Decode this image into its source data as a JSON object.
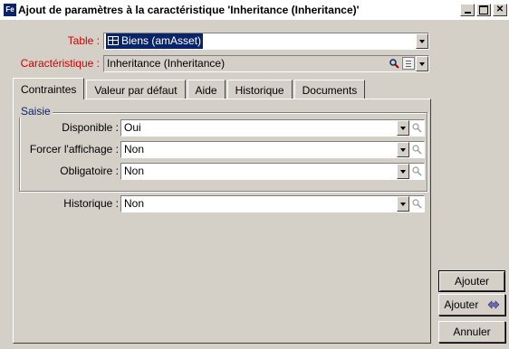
{
  "window": {
    "title": "Ajout de paramètres à la caractéristique 'Inheritance (Inheritance)'",
    "icon": "feature-window-icon",
    "buttons": [
      "minimize",
      "maximize",
      "close"
    ]
  },
  "header": {
    "table_label": "Table :",
    "table_value": "Biens (amAsset)",
    "characteristic_label": "Caractéristique :",
    "characteristic_value": "Inheritance (Inheritance)"
  },
  "tabs": [
    {
      "label": "Contraintes",
      "active": true
    },
    {
      "label": "Valeur par défaut",
      "active": false
    },
    {
      "label": "Aide",
      "active": false
    },
    {
      "label": "Historique",
      "active": false
    },
    {
      "label": "Documents",
      "active": false
    }
  ],
  "constraints": {
    "group_label": "Saisie",
    "fields": [
      {
        "label": "Disponible :",
        "value": "Oui"
      },
      {
        "label": "Forcer l'affichage :",
        "value": "Non"
      },
      {
        "label": "Obligatoire :",
        "value": "Non"
      }
    ],
    "history": {
      "label": "Historique :",
      "value": "Non"
    }
  },
  "actions": {
    "add_label": "Ajouter",
    "add_and_notify_label": "Ajouter",
    "cancel_label": "Annuler"
  },
  "colors": {
    "window_bg": "#d4d0c8",
    "selection": "#0a246a",
    "required_label": "#d00000"
  }
}
